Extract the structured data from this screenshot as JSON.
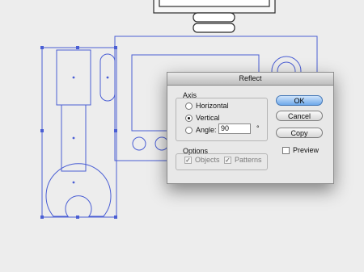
{
  "dialog": {
    "title": "Reflect",
    "axis": {
      "label": "Axis",
      "horizontal": "Horizontal",
      "vertical": "Vertical",
      "angle_label": "Angle:",
      "angle_value": "90",
      "degree": "°",
      "selected": "vertical"
    },
    "options": {
      "label": "Options",
      "objects": "Objects",
      "patterns": "Patterns",
      "objects_checked": true,
      "patterns_checked": true
    },
    "buttons": {
      "ok": "OK",
      "cancel": "Cancel",
      "copy": "Copy"
    },
    "preview": {
      "label": "Preview",
      "checked": false
    }
  },
  "colors": {
    "background": "#ededed",
    "selection": "#4a5ed4",
    "outline": "#2b2b2b"
  }
}
